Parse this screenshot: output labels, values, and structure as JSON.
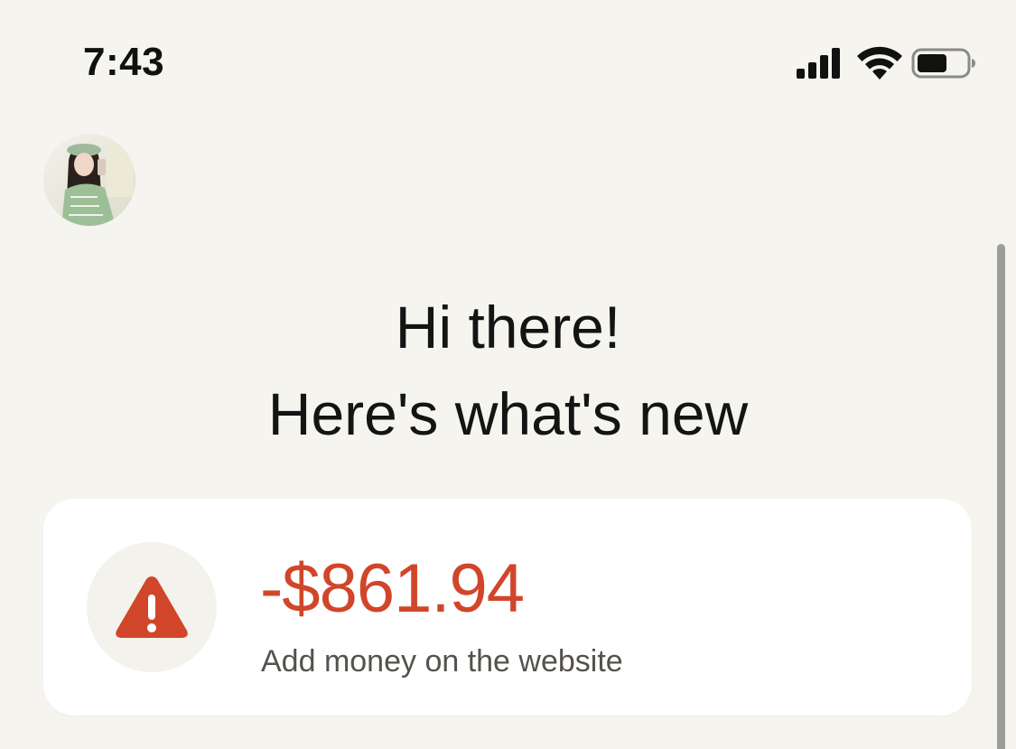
{
  "status_bar": {
    "time": "7:43",
    "icons": [
      "signal-icon",
      "wifi-icon",
      "battery-icon"
    ]
  },
  "profile": {
    "avatar_icon": "avatar"
  },
  "greeting": {
    "line1": "Hi there!",
    "line2": "Here's what's new"
  },
  "alert": {
    "icon": "warning-icon",
    "amount": "-$861.94",
    "message": "Add money on the website"
  },
  "colors": {
    "background": "#f5f4ef",
    "card": "#ffffff",
    "alert_red": "#d1462a",
    "text": "#141414",
    "subtext": "#55524d"
  }
}
